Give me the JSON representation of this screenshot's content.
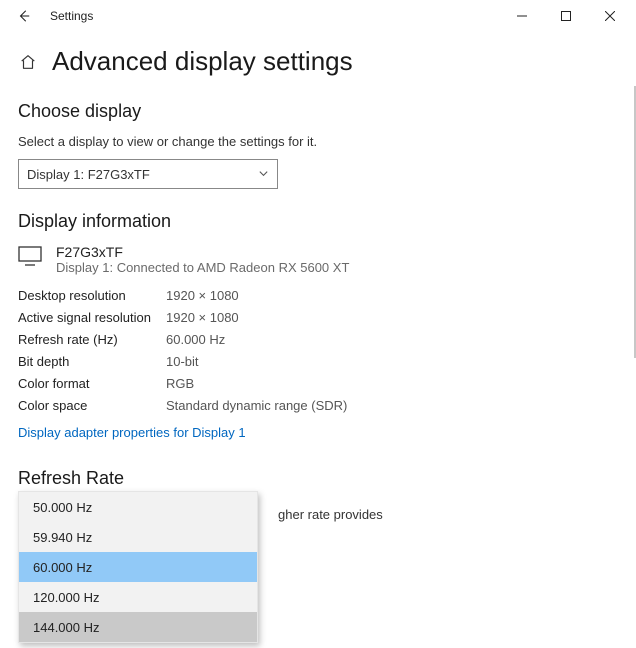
{
  "window": {
    "appTitle": "Settings"
  },
  "page": {
    "title": "Advanced display settings"
  },
  "chooseDisplay": {
    "heading": "Choose display",
    "desc": "Select a display to view or change the settings for it.",
    "selected": "Display 1: F27G3xTF"
  },
  "displayInfo": {
    "heading": "Display information",
    "deviceName": "F27G3xTF",
    "deviceSub": "Display 1: Connected to AMD Radeon RX 5600 XT",
    "rows": [
      {
        "label": "Desktop resolution",
        "value": "1920 × 1080"
      },
      {
        "label": "Active signal resolution",
        "value": "1920 × 1080"
      },
      {
        "label": "Refresh rate (Hz)",
        "value": "60.000 Hz"
      },
      {
        "label": "Bit depth",
        "value": "10-bit"
      },
      {
        "label": "Color format",
        "value": "RGB"
      },
      {
        "label": "Color space",
        "value": "Standard dynamic range (SDR)"
      }
    ],
    "adapterLink": "Display adapter properties for Display 1"
  },
  "refreshRate": {
    "heading": "Refresh Rate",
    "descFragment": "gher rate provides",
    "options": [
      "50.000 Hz",
      "59.940 Hz",
      "60.000 Hz",
      "120.000 Hz",
      "144.000 Hz"
    ],
    "selectedIndex": 2,
    "hoverIndex": 4
  }
}
